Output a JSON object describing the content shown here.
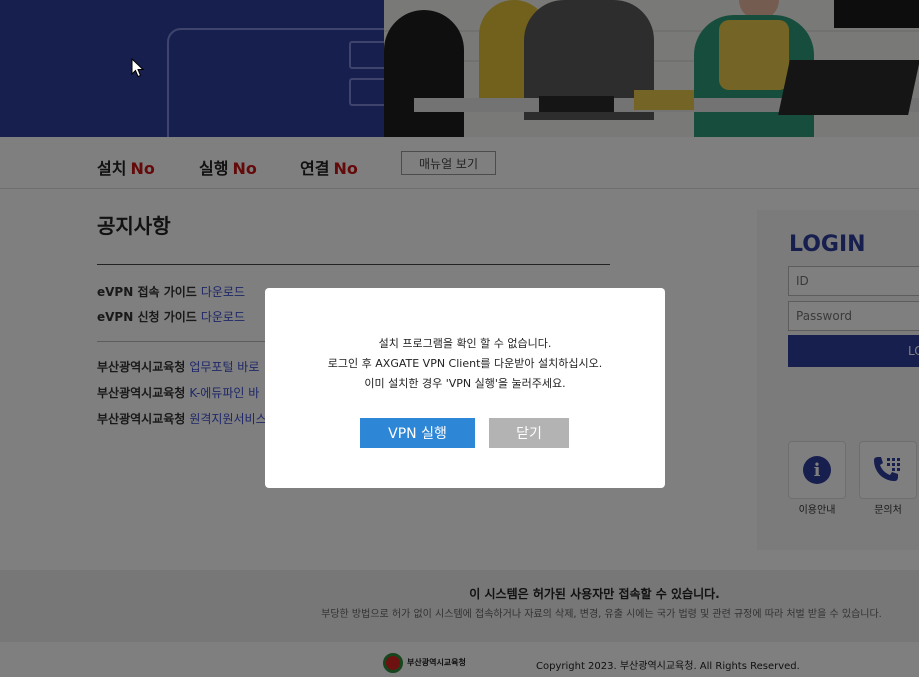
{
  "status": {
    "install": {
      "label": "설치",
      "value": "No"
    },
    "run": {
      "label": "실행",
      "value": "No"
    },
    "connect": {
      "label": "연결",
      "value": "No"
    },
    "manual_button": "매뉴얼 보기"
  },
  "notice": {
    "title": "공지사항",
    "items": [
      {
        "text": "eVPN 접속 가이드",
        "link": "다운로드"
      },
      {
        "text": "eVPN 신청 가이드",
        "link": "다운로드"
      },
      {
        "text": "부산광역시교육청",
        "link": "업무포털 바로"
      },
      {
        "text": "부산광역시교육청",
        "link": "K-에듀파인 바"
      },
      {
        "text": "부산광역시교육청",
        "link": "원격지원서비스"
      }
    ]
  },
  "login": {
    "title": "LOGIN",
    "id_placeholder": "ID",
    "password_placeholder": "Password",
    "button_label": "LO",
    "quick_links": [
      {
        "label": "이용안내",
        "icon": "info-icon"
      },
      {
        "label": "문의처",
        "icon": "phone-icon"
      }
    ]
  },
  "footer": {
    "main": "이 시스템은 허가된 사용자만 접속할 수 있습니다.",
    "sub": "부당한 방법으로 허가 없이 시스템에 접속하거나 자료의 삭제, 변경, 유출 시에는 국가 법령 및 관련 규정에 따라 처벌 받을 수 있습니다.",
    "org_name": "부산광역시교육청",
    "copyright": "Copyright 2023. 부산광역시교육청. All Rights Reserved."
  },
  "modal": {
    "line1": "설치 프로그램을 확인 할 수 없습니다.",
    "line2": "로그인 후 AXGATE VPN Client를 다운받아 설치하십시오.",
    "line3": "이미 설치한 경우 'VPN 실행'을 눌러주세요.",
    "vpn_button": "VPN 실행",
    "close_button": "닫기"
  },
  "colors": {
    "brand": "#2f3e9e",
    "status_no": "#c91515",
    "vpn_button": "#2e86d6",
    "close_button": "#b3b3b3"
  }
}
